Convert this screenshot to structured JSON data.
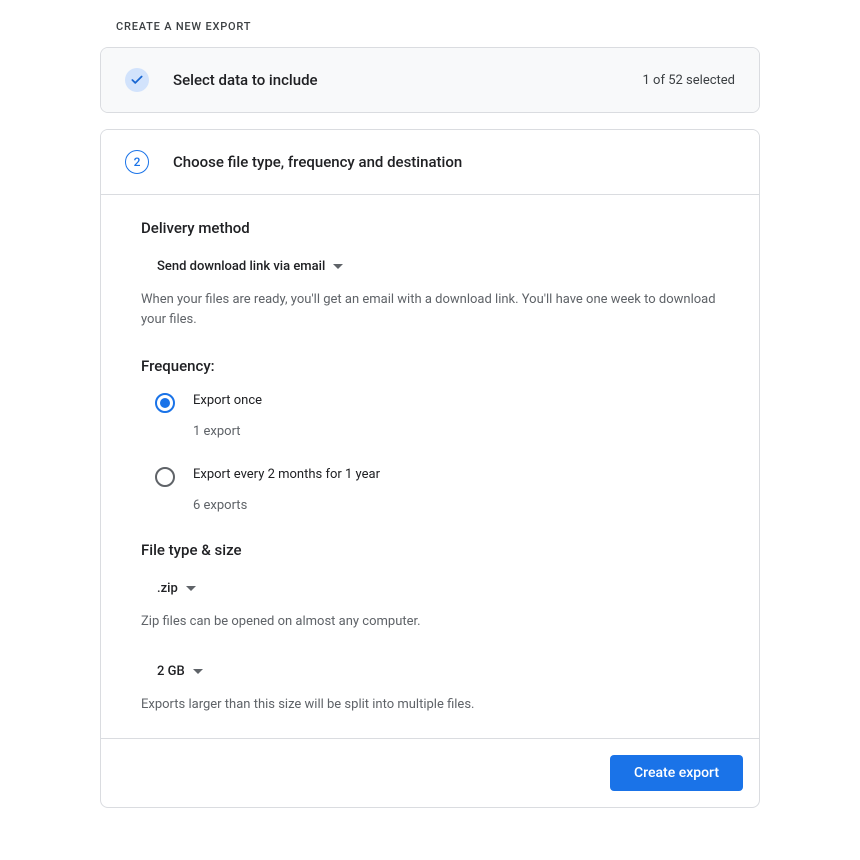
{
  "page_title": "CREATE A NEW EXPORT",
  "step1": {
    "title": "Select data to include",
    "status": "1 of 52 selected"
  },
  "step2": {
    "number": "2",
    "title": "Choose file type, frequency and destination",
    "delivery": {
      "heading": "Delivery method",
      "selected": "Send download link via email",
      "helper": "When your files are ready, you'll get an email with a download link. You'll have one week to download your files."
    },
    "frequency": {
      "heading": "Frequency:",
      "options": [
        {
          "label": "Export once",
          "sublabel": "1 export",
          "selected": true
        },
        {
          "label": "Export every 2 months for 1 year",
          "sublabel": "6 exports",
          "selected": false
        }
      ]
    },
    "filetype": {
      "heading": "File type & size",
      "type_selected": ".zip",
      "type_helper": "Zip files can be opened on almost any computer.",
      "size_selected": "2 GB",
      "size_helper": "Exports larger than this size will be split into multiple files."
    }
  },
  "create_button": "Create export"
}
